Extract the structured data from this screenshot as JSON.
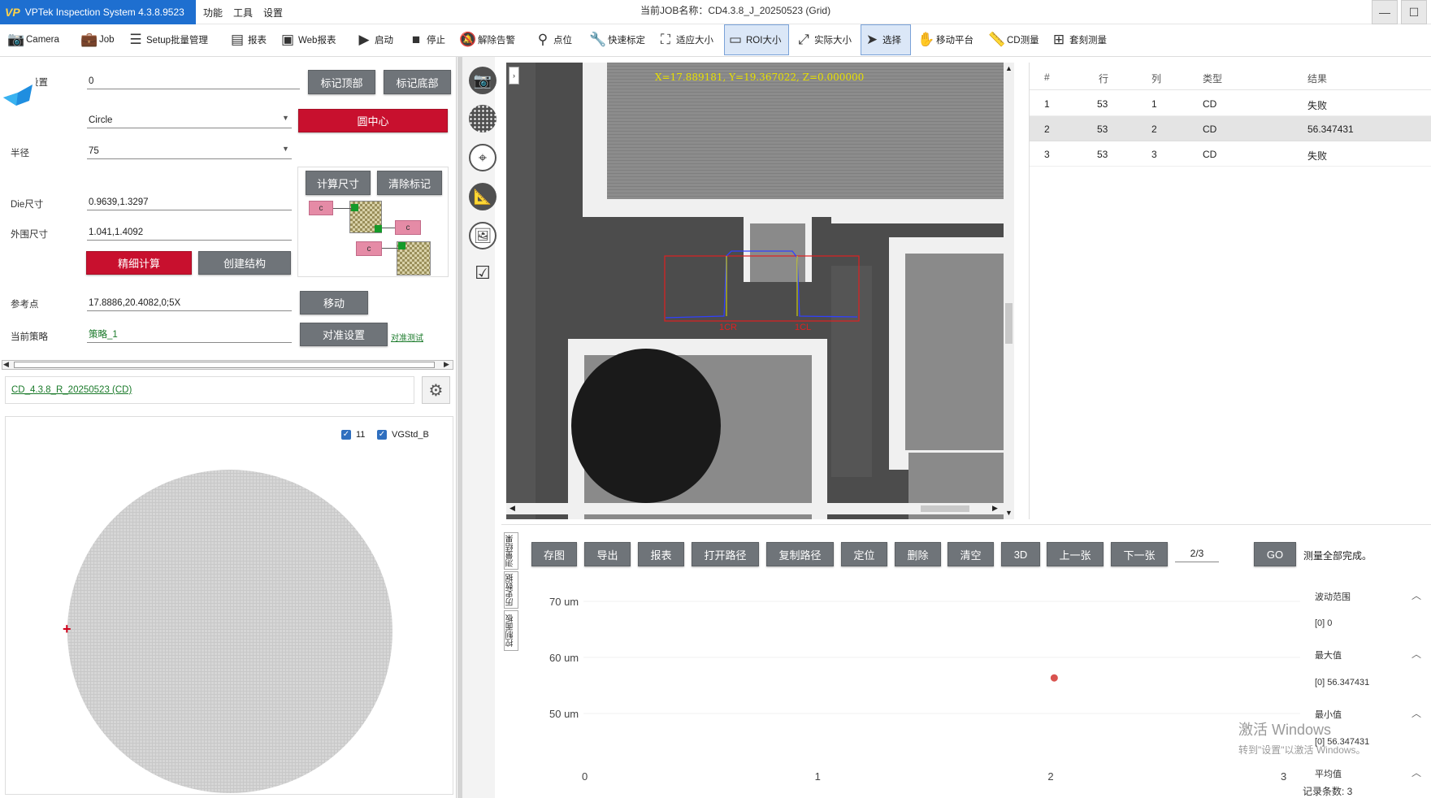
{
  "app": {
    "title": "VPTek Inspection System 4.3.8.9523",
    "logo_text": "VP",
    "menus": [
      "功能",
      "工具",
      "设置"
    ],
    "job_name": "当前JOB名称：CD4.3.8_J_20250523 (Grid)"
  },
  "toolbar": {
    "items": [
      {
        "label": "Camera",
        "icon": "camera-icon"
      },
      {
        "label": "Job",
        "icon": "briefcase-icon"
      },
      {
        "label": "Setup批量管理",
        "icon": "checklist-icon"
      },
      {
        "label": "报表",
        "icon": "report-icon"
      },
      {
        "label": "Web报表",
        "icon": "web-report-icon"
      },
      {
        "label": "启动",
        "icon": "play-icon"
      },
      {
        "label": "停止",
        "icon": "stop-icon"
      },
      {
        "label": "解除告警",
        "icon": "bell-off-icon"
      },
      {
        "label": "点位",
        "icon": "location-pin-icon"
      },
      {
        "label": "快速标定",
        "icon": "wrench-icon"
      },
      {
        "label": "适应大小",
        "icon": "fit-size-icon"
      },
      {
        "label": "ROI大小",
        "icon": "roi-icon"
      },
      {
        "label": "实际大小",
        "icon": "actual-size-icon"
      },
      {
        "label": "选择",
        "icon": "cursor-icon"
      },
      {
        "label": "移动平台",
        "icon": "hand-icon"
      },
      {
        "label": "CD测量",
        "icon": "ruler-icon"
      },
      {
        "label": "套刻测量",
        "icon": "plus-square-icon"
      }
    ],
    "active": [
      "ROI大小",
      "选择"
    ]
  },
  "left_panel": {
    "offset_label": "…距设置",
    "offset_value": "0",
    "mark_top": "标记顶部",
    "mark_bottom": "标记底部",
    "shape_value": "Circle",
    "circle_center": "圆中心",
    "radius_label": "半径",
    "radius_value": "75",
    "calc_size": "计算尺寸",
    "clear_marks": "清除标记",
    "die_label": "Die尺寸",
    "die_value": "0.9639,1.3297",
    "outer_label": "外围尺寸",
    "outer_value": "1.041,1.4092",
    "fine_calc": "精细计算",
    "create_structure": "创建结构",
    "ref_label": "参考点",
    "ref_value": "17.8886,20.4082,0;5X",
    "move": "移动",
    "strategy_label": "当前策略",
    "strategy_value": "策略_1",
    "align_settings": "对准设置",
    "align_test": "对准测试",
    "marker_c": "c",
    "recipe_link": "CD_4.3.8_R_20250523 (CD)",
    "wafer_check1": "11",
    "wafer_check2": "VGStd_B"
  },
  "viewer": {
    "coords": "X=17.889181, Y=19.367022, Z=0.000000",
    "label_left": "1CR",
    "label_right": "1CL"
  },
  "results_table": {
    "headers": [
      "#",
      "行",
      "列",
      "类型",
      "结果"
    ],
    "rows": [
      [
        "1",
        "53",
        "1",
        "CD",
        "失败"
      ],
      [
        "2",
        "53",
        "2",
        "CD",
        "56.347431"
      ],
      [
        "3",
        "53",
        "3",
        "CD",
        "失败"
      ]
    ],
    "selected_row": 2
  },
  "bottom_toolbar": {
    "buttons": [
      "存图",
      "导出",
      "报表",
      "打开路径",
      "复制路径",
      "定位",
      "删除",
      "清空",
      "3D",
      "上一张",
      "下一张"
    ],
    "page": "2/3",
    "go": "GO",
    "status": "测量全部完成。"
  },
  "vertical_tabs": [
    "控制面板",
    "历史数据",
    "测量结果"
  ],
  "chart_data": {
    "type": "scatter",
    "x_ticks": [
      "0",
      "1",
      "2",
      "3"
    ],
    "y_ticks": [
      "70 um",
      "60 um",
      "50 um"
    ],
    "ylim": [
      50,
      70
    ],
    "xlim": [
      0,
      3
    ],
    "points": [
      {
        "x": 2,
        "y": 56.347431
      }
    ],
    "point_color": "#d9534f"
  },
  "stats": {
    "range_label": "波动范围",
    "range_value": "[0]  0",
    "max_label": "最大值",
    "max_value": "[0]  56.347431",
    "min_label": "最小值",
    "min_value": "[0]  56.347431",
    "avg_label": "平均值",
    "record_count": "记录条数: 3"
  },
  "watermark": {
    "line1": "激活 Windows",
    "line2": "转到\"设置\"以激活 Windows。"
  }
}
